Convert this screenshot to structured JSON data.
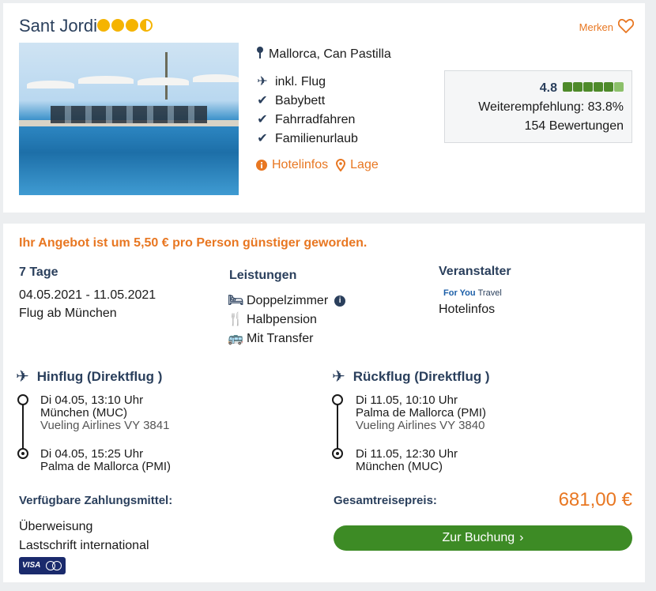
{
  "hotel": {
    "name": "Sant Jordi",
    "stars": 3.5,
    "merken": "Merken",
    "location": "Mallorca, Can Pastilla",
    "features": [
      "inkl. Flug",
      "Babybett",
      "Fahrradfahren",
      "Familienurlaub"
    ],
    "links": {
      "hotelinfos": "Hotelinfos",
      "lage": "Lage"
    },
    "rating": {
      "score": "4.8",
      "recommendation": "Weiterempfehlung: 83.8%",
      "reviews": "154 Bewertungen"
    }
  },
  "offer": {
    "savings_text": "Ihr Angebot ist um 5,50 € pro Person günstiger geworden.",
    "duration": "7 Tage",
    "dates": "04.05.2021 - 11.05.2021",
    "departure": "Flug ab München",
    "services_label": "Leistungen",
    "services": [
      "Doppelzimmer",
      "Halbpension",
      "Mit Transfer"
    ],
    "operator_label": "Veranstalter",
    "operator_logo": {
      "main": "For You",
      "suffix": "Travel"
    },
    "operator_link": "Hotelinfos",
    "outbound": {
      "title": "Hinflug (Direktflug )",
      "dep_time": "Di 04.05, 13:10 Uhr",
      "dep_airport": "München (MUC)",
      "airline": "Vueling Airlines VY 3841",
      "arr_time": "Di 04.05, 15:25 Uhr",
      "arr_airport": "Palma de Mallorca (PMI)"
    },
    "return": {
      "title": "Rückflug (Direktflug )",
      "dep_time": "Di 11.05, 10:10 Uhr",
      "dep_airport": "Palma de Mallorca (PMI)",
      "airline": "Vueling Airlines VY 3840",
      "arr_time": "Di 11.05, 12:30 Uhr",
      "arr_airport": "München (MUC)"
    },
    "payment_label": "Verfügbare Zahlungsmittel:",
    "payment_methods": [
      "Überweisung",
      "Lastschrift international"
    ],
    "card_logos": {
      "visa": "VISA"
    },
    "total_label": "Gesamtreisepreis:",
    "total_price": "681,00 €",
    "book_button": "Zur Buchung"
  },
  "colors": {
    "accent": "#e87722",
    "navy": "#2a3f5c",
    "button": "#3d8b25"
  }
}
